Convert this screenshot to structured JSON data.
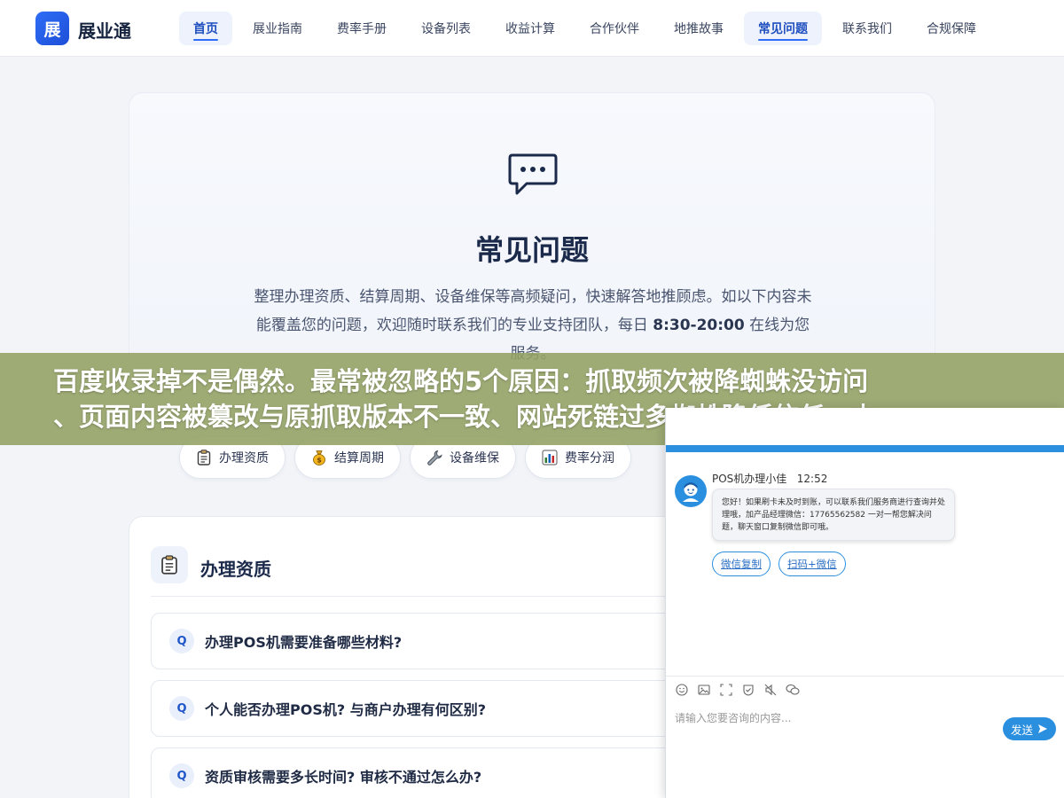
{
  "brand": {
    "logo_char": "展",
    "name": "展业通"
  },
  "nav": {
    "items": [
      {
        "label": "首页"
      },
      {
        "label": "展业指南"
      },
      {
        "label": "费率手册"
      },
      {
        "label": "设备列表"
      },
      {
        "label": "收益计算"
      },
      {
        "label": "合作伙伴"
      },
      {
        "label": "地推故事"
      },
      {
        "label": "常见问题"
      },
      {
        "label": "联系我们"
      },
      {
        "label": "合规保障"
      }
    ],
    "active": [
      "首页",
      "常见问题"
    ]
  },
  "hero": {
    "icon": "chat-bubble-icon",
    "title": "常见问题",
    "desc_part1": "整理办理资质、结算周期、设备维保等高频疑问，快速解答地推顾虑。如以下内容未能覆盖您的问题，欢迎随时联系我们的专业支持团队，每日 ",
    "desc_hours": "8:30-20:00",
    "desc_part2": " 在线为您服务。"
  },
  "banner": {
    "line1": "百度收录掉不是偶然。最常被忽略的5个原因：抓取频次被降蜘蛛没访问",
    "line2": "、页面内容被篡改与原抓取版本不一致、网站死链过多蜘蛛降低信任、内"
  },
  "categories": [
    {
      "label": "办理资质",
      "icon": "clipboard-icon"
    },
    {
      "label": "结算周期",
      "icon": "money-bag-icon"
    },
    {
      "label": "设备维保",
      "icon": "wrench-icon"
    },
    {
      "label": "费率分润",
      "icon": "bar-chart-icon"
    }
  ],
  "faq": {
    "section_title": "办理资质",
    "section_icon": "clipboard-icon",
    "badge": "Q",
    "questions": [
      "办理POS机需要准备哪些材料?",
      "个人能否办理POS机? 与商户办理有何区别?",
      "资质审核需要多长时间? 审核不通过怎么办?"
    ]
  },
  "chat": {
    "minimize": "—",
    "maximize": "□",
    "agent_name": "POS机办理小佳",
    "time": "12:52",
    "message": "您好！如果刷卡未及时到账，可以联系我们服务商进行查询并处理哦，加产品经理微信：17765562582 一对一帮您解决问题，聊天窗口复制微信即可哦。",
    "buttons": [
      "微信复制",
      "扫码+微信"
    ],
    "placeholder": "请输入您要咨询的内容...",
    "send_label": "发送"
  },
  "colors": {
    "accent": "#2f6df6",
    "chat_accent": "#2b8fe0",
    "banner_bg": "#92a062"
  }
}
